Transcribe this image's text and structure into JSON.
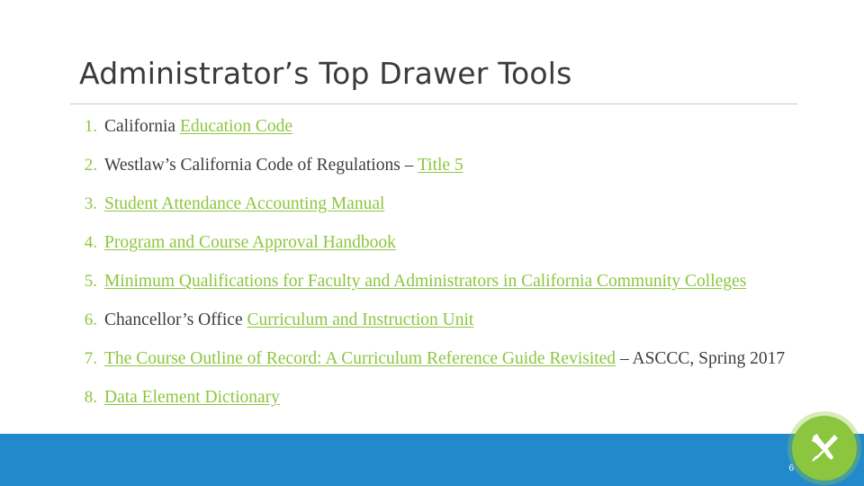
{
  "slide": {
    "title": "Administrator’s Top Drawer Tools",
    "page_number": "6",
    "accent_color": "#8CC63E",
    "bar_color": "#2389CD",
    "logo_icon": "wrench-screwdriver-icon",
    "items": [
      {
        "number": "1.",
        "parts": [
          {
            "text": "California ",
            "link": false
          },
          {
            "text": "Education Code",
            "link": true
          }
        ]
      },
      {
        "number": "2.",
        "parts": [
          {
            "text": "Westlaw’s California Code of Regulations – ",
            "link": false
          },
          {
            "text": "Title 5",
            "link": true
          }
        ]
      },
      {
        "number": "3.",
        "parts": [
          {
            "text": "Student Attendance Accounting Manual",
            "link": true
          }
        ]
      },
      {
        "number": "4.",
        "parts": [
          {
            "text": "Program and Course Approval Handbook",
            "link": true
          }
        ]
      },
      {
        "number": "5.",
        "parts": [
          {
            "text": "Minimum Qualifications for Faculty and Administrators in California Community Colleges",
            "link": true
          }
        ]
      },
      {
        "number": "6.",
        "parts": [
          {
            "text": "Chancellor’s Office ",
            "link": false
          },
          {
            "text": "Curriculum and Instruction Unit",
            "link": true
          }
        ]
      },
      {
        "number": "7.",
        "parts": [
          {
            "text": "The Course Outline of Record:  A Curriculum Reference Guide Revisited",
            "link": true
          },
          {
            "text": " – ASCCC, Spring 2017",
            "link": false
          }
        ]
      },
      {
        "number": "8.",
        "parts": [
          {
            "text": "Data Element Dictionary",
            "link": true
          }
        ]
      }
    ]
  }
}
